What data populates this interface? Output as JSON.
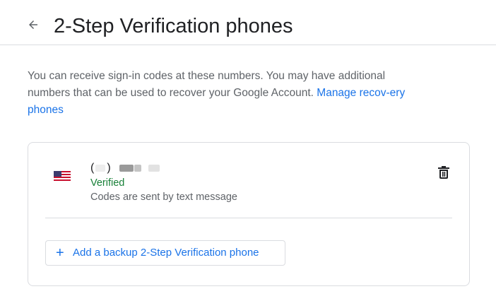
{
  "header": {
    "title": "2-Step Verification phones",
    "back_icon": "arrow-back-icon"
  },
  "description": {
    "text": "You can receive sign-in codes at these numbers. You may have additional numbers that can be used to recover your Google Account.",
    "link": "Manage recov-ery phones"
  },
  "phone_entry": {
    "flag_icon": "us-flag-icon",
    "number_open": "(",
    "number_close": ")",
    "status": "Verified",
    "method": "Codes are sent by text message",
    "delete_icon": "trash-icon"
  },
  "add_button": {
    "icon": "+",
    "label": "Add a backup 2-Step Verification phone"
  },
  "colors": {
    "accent": "#1a73e8",
    "verified": "#188038",
    "divider": "#dadce0"
  }
}
